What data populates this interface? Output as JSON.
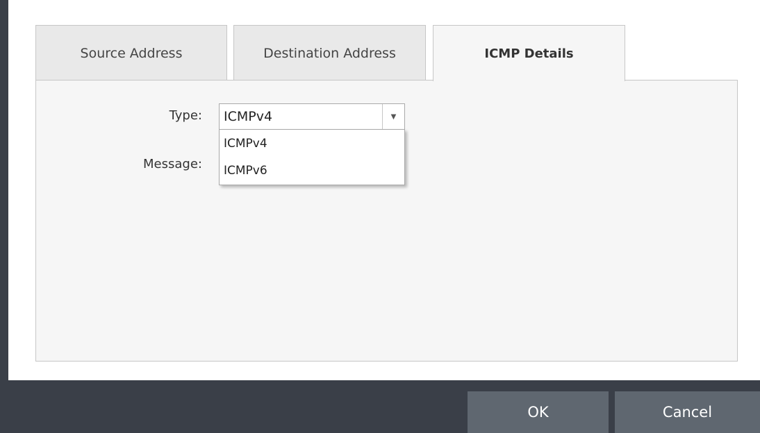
{
  "tabs": [
    {
      "label": "Source Address",
      "active": false
    },
    {
      "label": "Destination Address",
      "active": false
    },
    {
      "label": "ICMP Details",
      "active": true
    }
  ],
  "form": {
    "type_label": "Type:",
    "message_label": "Message:",
    "type_select": {
      "value": "ICMPv4",
      "options": [
        "ICMPv4",
        "ICMPv6"
      ],
      "expanded": true
    }
  },
  "footer": {
    "ok_label": "OK",
    "cancel_label": "Cancel"
  },
  "colors": {
    "footer_background": "#3a3f48",
    "button_background": "#5f6770",
    "tab_inactive": "#e9e9e9",
    "panel_background": "#f6f6f6"
  }
}
